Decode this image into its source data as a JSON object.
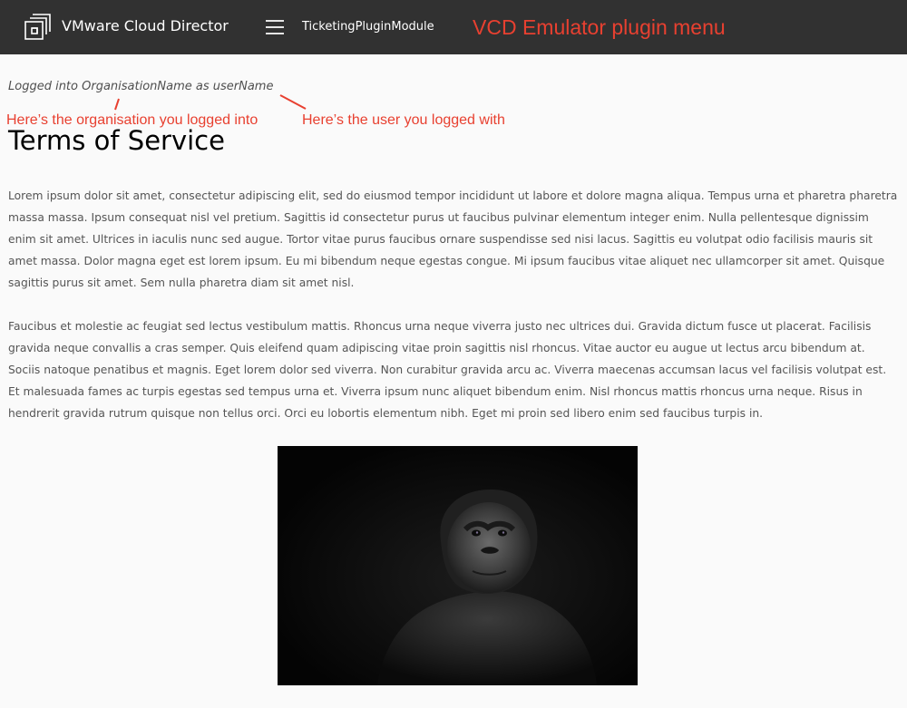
{
  "header": {
    "app_title": "VMware Cloud Director",
    "module_label": "TicketingPluginModule",
    "annotation": "VCD Emulator plugin menu",
    "logo_icon": "vmware-cloud-director-logo-icon",
    "menu_icon": "hamburger-menu-icon",
    "background_color": "#313131"
  },
  "main": {
    "login_status": "Logged into OrganisationName as userName",
    "annotation_org": "Here’s the organisation you logged into",
    "annotation_user": "Here’s the user you logged with",
    "title": "Terms of Service",
    "paragraphs": [
      "Lorem ipsum dolor sit amet, consectetur adipiscing elit, sed do eiusmod tempor incididunt ut labore et dolore magna aliqua. Tempus urna et pharetra pharetra massa massa. Ipsum consequat nisl vel pretium. Sagittis id consectetur purus ut faucibus pulvinar elementum integer enim. Nulla pellentesque dignissim enim sit amet. Ultrices in iaculis nunc sed augue. Tortor vitae purus faucibus ornare suspendisse sed nisi lacus. Sagittis eu volutpat odio facilisis mauris sit amet massa. Dolor magna eget est lorem ipsum. Eu mi bibendum neque egestas congue. Mi ipsum faucibus vitae aliquet nec ullamcorper sit amet. Quisque sagittis purus sit amet. Sem nulla pharetra diam sit amet nisl.",
      "Faucibus et molestie ac feugiat sed lectus vestibulum mattis. Rhoncus urna neque viverra justo nec ultrices dui. Gravida dictum fusce ut placerat. Facilisis gravida neque convallis a cras semper. Quis eleifend quam adipiscing vitae proin sagittis nisl rhoncus. Vitae auctor eu augue ut lectus arcu bibendum at. Sociis natoque penatibus et magnis. Eget lorem dolor sed viverra. Non curabitur gravida arcu ac. Viverra maecenas accumsan lacus vel facilisis volutpat est. Et malesuada fames ac turpis egestas sed tempus urna et. Viverra ipsum nunc aliquet bibendum enim. Nisl rhoncus mattis rhoncus urna neque. Risus in hendrerit gravida rutrum quisque non tellus orci. Orci eu lobortis elementum nibh. Eget mi proin sed libero enim sed faucibus turpis in."
    ],
    "annotation_color": "#e84030"
  }
}
